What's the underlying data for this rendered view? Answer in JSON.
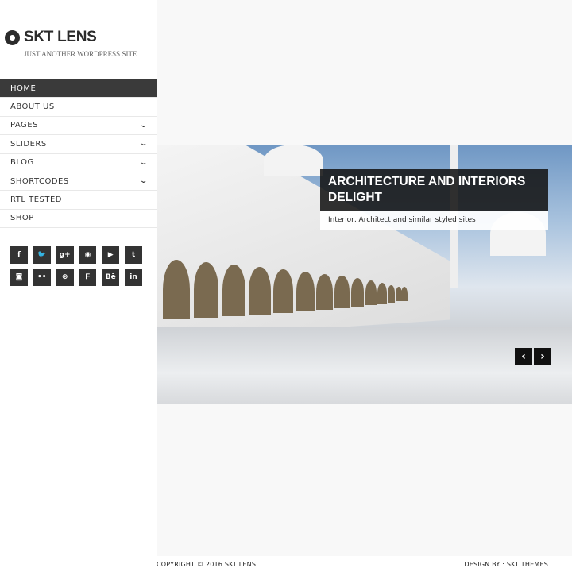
{
  "site": {
    "title": "SKT LENS",
    "tagline": "JUST ANOTHER WORDPRESS SITE",
    "logo_icon": "aperture-icon"
  },
  "menu": [
    {
      "label": "HOME",
      "active": true,
      "has_submenu": false
    },
    {
      "label": "ABOUT US",
      "has_submenu": false
    },
    {
      "label": "PAGES",
      "has_submenu": true
    },
    {
      "label": "SLIDERS",
      "has_submenu": true
    },
    {
      "label": "BLOG",
      "has_submenu": true
    },
    {
      "label": "SHORTCODES",
      "has_submenu": true
    },
    {
      "label": "RTL TESTED",
      "has_submenu": false
    },
    {
      "label": "SHOP",
      "has_submenu": false
    }
  ],
  "social": [
    {
      "icon": "facebook-icon",
      "glyph": "f"
    },
    {
      "icon": "twitter-icon",
      "glyph": "🐦"
    },
    {
      "icon": "google-plus-icon",
      "glyph": "g+"
    },
    {
      "icon": "pinterest-icon",
      "glyph": "◉"
    },
    {
      "icon": "youtube-icon",
      "glyph": "▶"
    },
    {
      "icon": "tumblr-icon",
      "glyph": "t"
    },
    {
      "icon": "instagram-icon",
      "glyph": "◙"
    },
    {
      "icon": "flickr-icon",
      "glyph": "••"
    },
    {
      "icon": "dribbble-icon",
      "glyph": "⊛"
    },
    {
      "icon": "foursquare-icon",
      "glyph": "ᖴ"
    },
    {
      "icon": "behance-icon",
      "glyph": "Bē"
    },
    {
      "icon": "linkedin-icon",
      "glyph": "in"
    }
  ],
  "slider": {
    "title": "ARCHITECTURE AND INTERIORS DELIGHT",
    "subtitle": "Interior, Architect and similar styled sites",
    "prev": "‹",
    "next": "›"
  },
  "footer": {
    "copyright": "COPYRIGHT © 2016 SKT LENS",
    "design": "DESIGN BY : SKT THEMES"
  },
  "colors": {
    "menu_active": "#3a3a3a",
    "accent_dark": "#333333"
  }
}
